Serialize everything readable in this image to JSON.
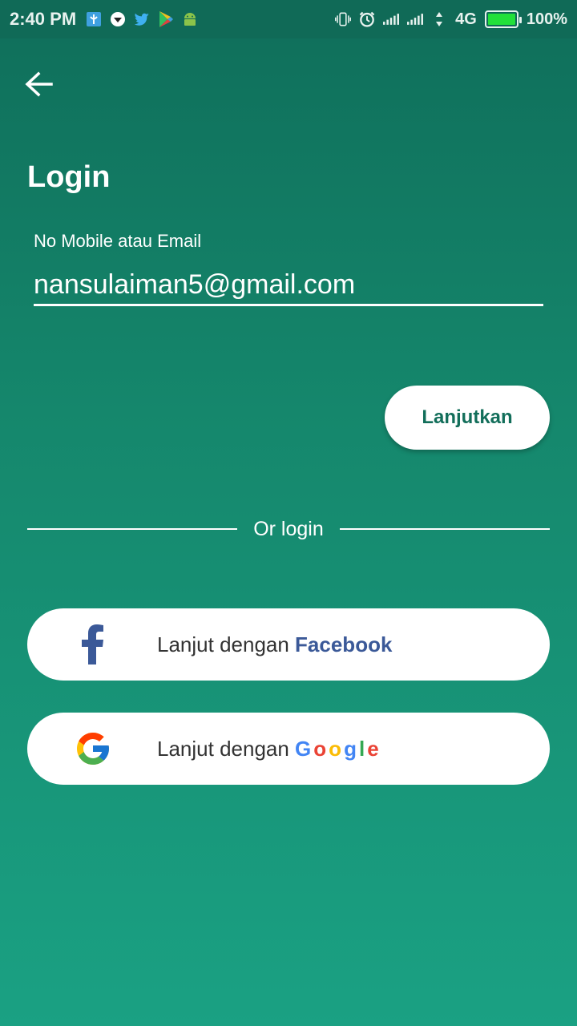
{
  "status_bar": {
    "time": "2:40 PM",
    "network": "4G",
    "battery": "100%",
    "battery_level": 1.0,
    "notification_icons": [
      "app-icon",
      "shield-icon",
      "twitter-icon",
      "play-store-icon",
      "android-icon"
    ]
  },
  "header": {
    "back_icon": "arrow-left-icon",
    "title": "Login"
  },
  "form": {
    "field_label": "No Mobile atau Email",
    "email_value": "nansulaiman5@gmail.com",
    "continue_label": "Lanjutkan"
  },
  "divider": {
    "text": "Or login"
  },
  "social": {
    "facebook_prefix": "Lanjut dengan ",
    "facebook_brand": "Facebook",
    "google_prefix": "Lanjut dengan ",
    "google_letters": [
      "G",
      "o",
      "o",
      "g",
      "l",
      "e"
    ]
  },
  "colors": {
    "background_top": "#0f6e5a",
    "background_bottom": "#1aa183",
    "button_text": "#126e5a",
    "facebook": "#3b5998",
    "google": [
      "#4285f4",
      "#ea4335",
      "#fbbc05",
      "#4285f4",
      "#34a853",
      "#ea4335"
    ]
  }
}
